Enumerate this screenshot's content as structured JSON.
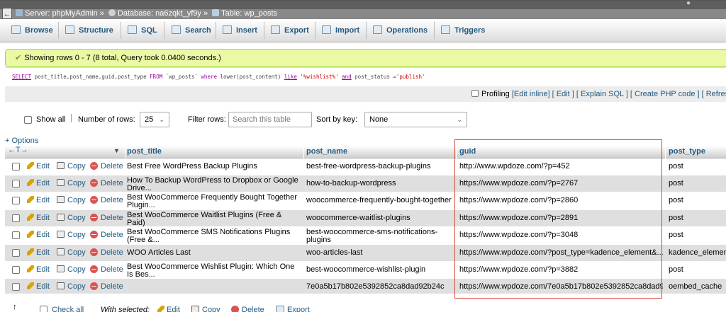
{
  "breadcrumb": {
    "back": "←",
    "server": "Server: phpMyAdmin",
    "database": "Database: na6zqkt_yf9y",
    "table": "Table: wp_posts",
    "sep": "»"
  },
  "tabs": [
    "Browse",
    "Structure",
    "SQL",
    "Search",
    "Insert",
    "Export",
    "Import",
    "Operations",
    "Triggers"
  ],
  "message": "Showing rows 0 - 7 (8 total, Query took 0.0400 seconds.)",
  "sql": {
    "select": "SELECT",
    "cols": " post_title,post_name,guid,post_type ",
    "from": "FROM",
    "table": " `wp_posts` ",
    "where": "where",
    "fn": " lower(post_content) ",
    "like": "like",
    "pattern": " '%wishlist%' ",
    "and": "and",
    "cond": " post_status =",
    "value": "'publish'"
  },
  "profiling": {
    "label": "Profiling",
    "links": "[Edit inline] [ Edit ] [ Explain SQL ] [ Create PHP code ] [ Refresh"
  },
  "nav": {
    "show_all": "Show all",
    "num_rows_label": "Number of rows:",
    "num_rows_value": "25",
    "filter_label": "Filter rows:",
    "filter_placeholder": "Search this table",
    "sort_label": "Sort by key:",
    "sort_value": "None"
  },
  "options_link": "+ Options",
  "columns": {
    "arrows": "←T→",
    "post_title": "post_title",
    "post_name": "post_name",
    "guid": "guid",
    "post_type": "post_type"
  },
  "actions": {
    "edit": "Edit",
    "copy": "Copy",
    "delete": "Delete"
  },
  "rows": [
    {
      "post_title": "Best Free WordPress Backup Plugins",
      "post_name": "best-free-wordpress-backup-plugins",
      "guid": "http://www.wpdoze.com/?p=452",
      "post_type": "post"
    },
    {
      "post_title": "How To Backup WordPress to Dropbox or Google Drive...",
      "post_name": "how-to-backup-wordpress",
      "guid": "https://www.wpdoze.com/?p=2767",
      "post_type": "post"
    },
    {
      "post_title": "Best WooCommerce Frequently Bought Together Plugin...",
      "post_name": "woocommerce-frequently-bought-together",
      "guid": "https://www.wpdoze.com/?p=2860",
      "post_type": "post"
    },
    {
      "post_title": "Best WooCommerce Waitlist Plugins (Free & Paid)",
      "post_name": "woocommerce-waitlist-plugins",
      "guid": "https://www.wpdoze.com/?p=2891",
      "post_type": "post"
    },
    {
      "post_title": "Best WooCommerce SMS Notifications Plugins (Free &...",
      "post_name": "best-woocommerce-sms-notifications-plugins",
      "guid": "https://www.wpdoze.com/?p=3048",
      "post_type": "post"
    },
    {
      "post_title": "WOO Articles Last",
      "post_name": "woo-articles-last",
      "guid": "https://www.wpdoze.com/?post_type=kadence_element&...",
      "post_type": "kadence_element"
    },
    {
      "post_title": "Best WooCommerce Wishlist Plugin: Which One Is Bes...",
      "post_name": "best-woocommerce-wishlist-plugin",
      "guid": "https://www.wpdoze.com/?p=3882",
      "post_type": "post"
    },
    {
      "post_title": "",
      "post_name": "7e0a5b17b802e5392852ca8dad92b24c",
      "guid": "https://www.wpdoze.com/7e0a5b17b802e5392852ca8dad9...",
      "post_type": "oembed_cache"
    }
  ],
  "bottom": {
    "check_all": "Check all",
    "with_selected": "With selected:",
    "edit": "Edit",
    "copy": "Copy",
    "delete": "Delete",
    "export": "Export"
  }
}
